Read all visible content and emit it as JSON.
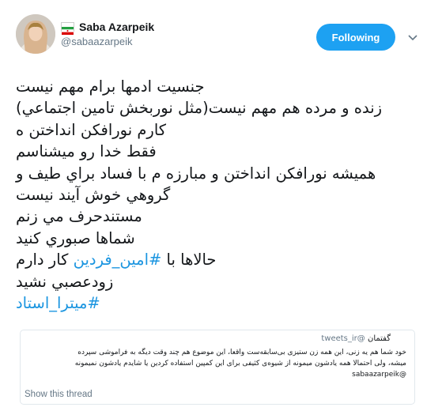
{
  "author": {
    "display_name": "Saba Azarpeik",
    "handle": "@sabaazarpeik",
    "flag_icon": "iran-flag-icon"
  },
  "actions": {
    "follow_label": "Following",
    "more_icon": "chevron-down-icon"
  },
  "colors": {
    "follow_button": "#1da1f2",
    "hashtag": "#1b95e0",
    "secondary_text": "#657786"
  },
  "tweet": {
    "lines": [
      "جنسيت ادمها برام مهم نيست",
      "زنده و مرده هم مهم نيست(مثل نوربخش تامين اجتماعي)",
      "كارم نورافكن انداختن ه",
      "فقط خدا رو ميشناسم",
      "هميشه نورافكن انداختن و مبارزه م با فساد براي طيف و",
      "گروهي خوش آيند نيست",
      "مستندحرف مي زنم",
      "شماها صبوري كنيد"
    ],
    "line_hashtag_prefix": "حالاها با ",
    "line_hashtag": "#امين_فردين",
    "line_hashtag_suffix": " كار دارم",
    "line_after": "زودعصبي نشيد",
    "final_hashtag": "#ميترا_استاد"
  },
  "quote": {
    "handle": "@tweets_ir",
    "verb": "گفتمان",
    "lines": [
      "خود شما هم یه زنی، این همه زن ستیزی بی‌سابقه‌ست واقعا، این موضوع هم چند وقت دیگه به فراموشی سپرده",
      "میشه، ولی احتمالا همه یادشون میمونه از شیوه‌ی کثیفی برای این کمپین استفاده کردین یا شایدم یادشون نمیمونه",
      "@sabaazarpeik"
    ]
  },
  "show_thread": "Show this thread"
}
